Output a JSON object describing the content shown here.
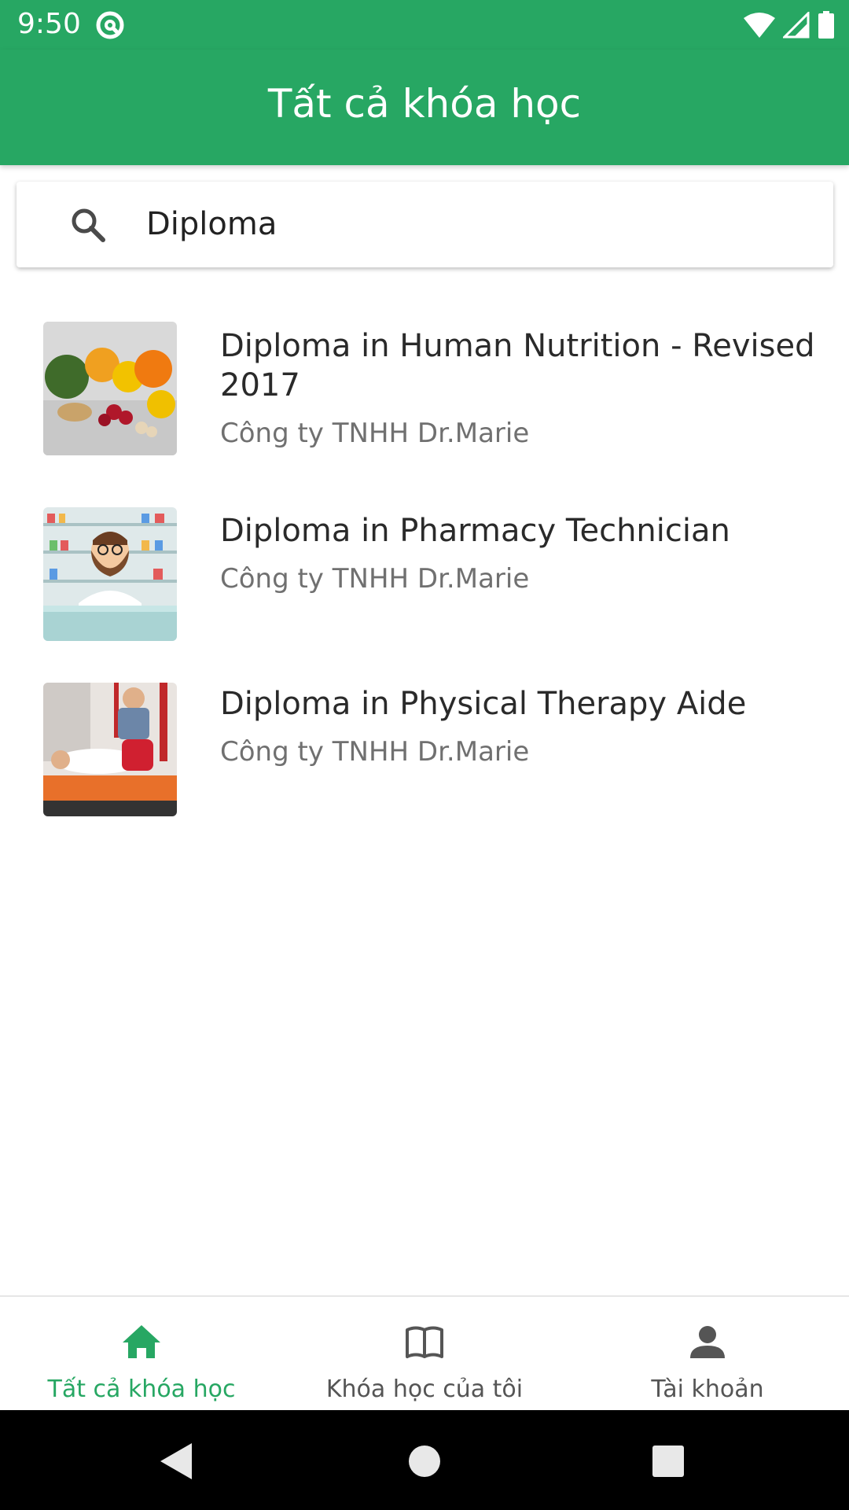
{
  "status_bar": {
    "time": "9:50"
  },
  "header": {
    "title": "Tất cả khóa học"
  },
  "search": {
    "value": "Diploma"
  },
  "courses": [
    {
      "title": "Diploma in Human Nutrition - Revised 2017",
      "company": "Công ty TNHH Dr.Marie"
    },
    {
      "title": "Diploma in Pharmacy Technician",
      "company": "Công ty TNHH Dr.Marie"
    },
    {
      "title": "Diploma in Physical Therapy Aide",
      "company": "Công ty TNHH Dr.Marie"
    }
  ],
  "bottom_nav": {
    "items": [
      {
        "label": "Tất cả khóa học",
        "icon": "home-icon",
        "active": true
      },
      {
        "label": "Khóa học của tôi",
        "icon": "book-open-icon",
        "active": false
      },
      {
        "label": "Tài khoản",
        "icon": "person-icon",
        "active": false
      }
    ]
  },
  "colors": {
    "primary": "#27a763",
    "inactive": "#555555",
    "text": "#2a2a2a",
    "subtext": "#707070"
  }
}
